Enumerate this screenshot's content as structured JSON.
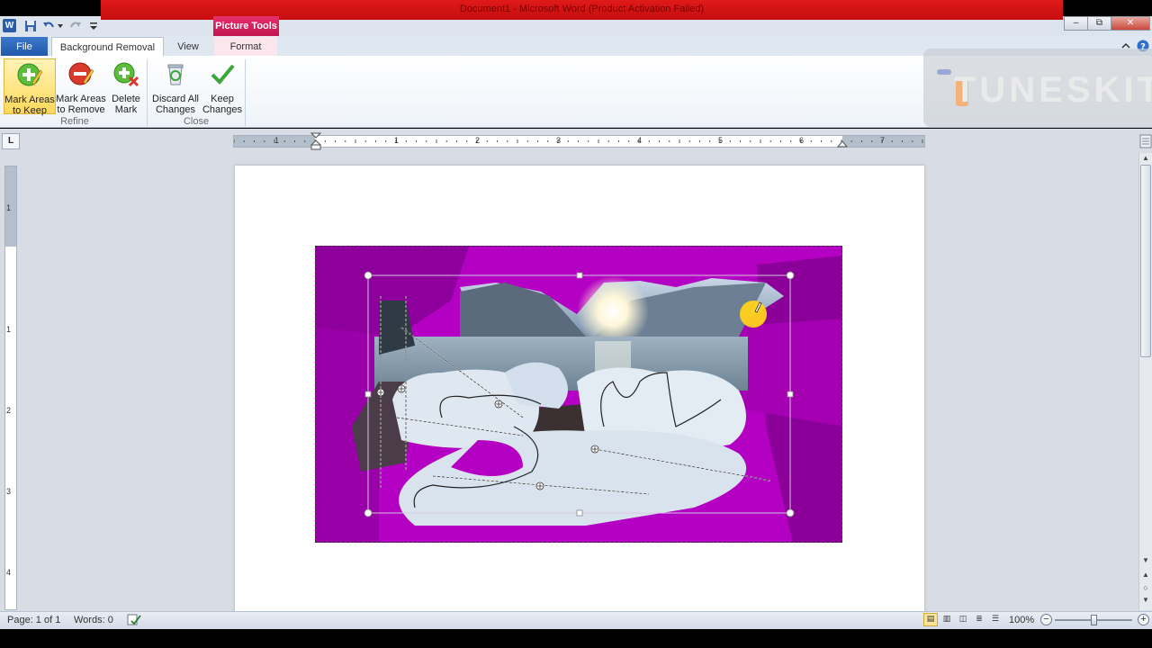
{
  "window": {
    "title": "Document1  -  Microsoft Word (Product Activation Failed)",
    "context_tab": "Picture Tools",
    "app_logo": "W",
    "minimize": "–",
    "restore": "⧉",
    "close": "✕"
  },
  "tabs": {
    "file": "File",
    "background_removal": "Background Removal",
    "view": "View",
    "format": "Format"
  },
  "ribbon": {
    "refine_group": "Refine",
    "close_group": "Close",
    "mark_keep": [
      "Mark Areas",
      "to Keep"
    ],
    "mark_remove": [
      "Mark Areas",
      "to Remove"
    ],
    "delete_mark": [
      "Delete",
      "Mark"
    ],
    "discard_all": [
      "Discard All",
      "Changes"
    ],
    "keep_changes": [
      "Keep",
      "Changes"
    ]
  },
  "watermark": {
    "text": "TUNESKIT"
  },
  "ruler": {
    "corner": "L",
    "h_numbers": [
      "1",
      "1",
      "2",
      "3",
      "4",
      "5",
      "6",
      "7"
    ],
    "v_numbers": [
      "1",
      "1",
      "2",
      "3",
      "4"
    ]
  },
  "statusbar": {
    "page": "Page: 1 of 1",
    "words": "Words: 0",
    "zoom": "100%",
    "zoom_minus": "−",
    "zoom_plus": "+"
  },
  "colors": {
    "removal_overlay": "#b400c2",
    "title_bar": "#d11414",
    "picture_tools": "#d41f5b",
    "file_tab": "#2a64b8"
  }
}
